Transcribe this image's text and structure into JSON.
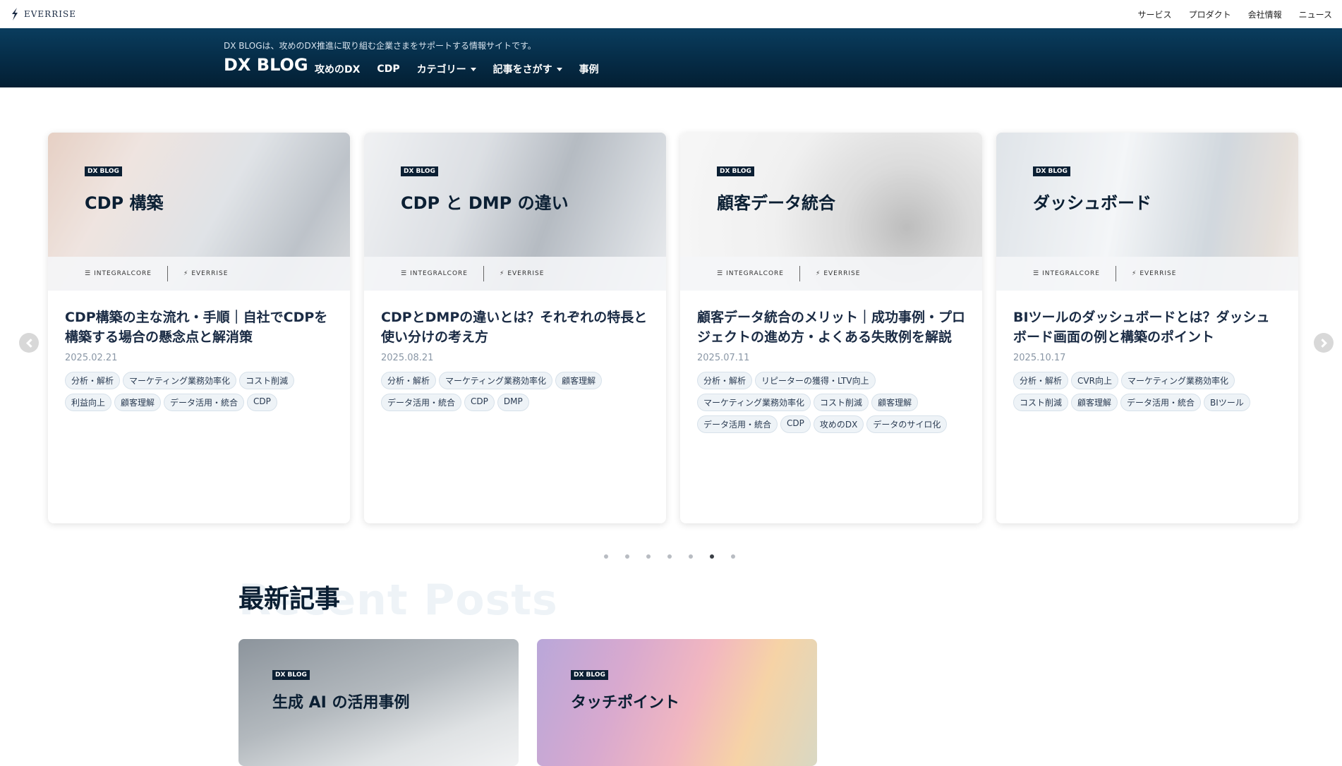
{
  "topbar": {
    "brand": "EVERRISE",
    "nav": [
      "サービス",
      "プロダクト",
      "会社情報",
      "ニュース"
    ]
  },
  "dxheader": {
    "tagline": "DX BLOGは、攻めのDX推進に取り組む企業さまをサポートする情報サイトです。",
    "logo": "DX BLOG",
    "nav": [
      {
        "label": "攻めのDX",
        "dropdown": false
      },
      {
        "label": "CDP",
        "dropdown": false
      },
      {
        "label": "カテゴリー",
        "dropdown": true
      },
      {
        "label": "記事をさがす",
        "dropdown": true
      },
      {
        "label": "事例",
        "dropdown": false
      }
    ]
  },
  "logos": {
    "integralcore": "INTEGRALCORE",
    "everrise": "EVERRISE"
  },
  "cards": [
    {
      "badge": "DX BLOG",
      "thumb_title": "CDP 構築",
      "title": "CDP構築の主な流れ・手順｜自社でCDPを構築する場合の懸念点と解消策",
      "date": "2025.02.21",
      "tags": [
        "分析・解析",
        "マーケティング業務効率化",
        "コスト削減",
        "利益向上",
        "顧客理解",
        "データ活用・統合",
        "CDP"
      ]
    },
    {
      "badge": "DX BLOG",
      "thumb_title": "CDP と DMP の違い",
      "title": "CDPとDMPの違いとは？それぞれの特長と使い分けの考え方",
      "date": "2025.08.21",
      "tags": [
        "分析・解析",
        "マーケティング業務効率化",
        "顧客理解",
        "データ活用・統合",
        "CDP",
        "DMP"
      ]
    },
    {
      "badge": "DX BLOG",
      "thumb_title": "顧客データ統合",
      "title": "顧客データ統合のメリット｜成功事例・プロジェクトの進め方・よくある失敗例を解説",
      "date": "2025.07.11",
      "tags": [
        "分析・解析",
        "リピーターの獲得・LTV向上",
        "マーケティング業務効率化",
        "コスト削減",
        "顧客理解",
        "データ活用・統合",
        "CDP",
        "攻めのDX",
        "データのサイロ化"
      ]
    },
    {
      "badge": "DX BLOG",
      "thumb_title": "ダッシュボード",
      "title": "BIツールのダッシュボードとは？ダッシュボード画面の例と構築のポイント",
      "date": "2025.10.17",
      "tags": [
        "分析・解析",
        "CVR向上",
        "マーケティング業務効率化",
        "コスト削減",
        "顧客理解",
        "データ活用・統合",
        "BIツール"
      ]
    }
  ],
  "carousel": {
    "dot_count": 7,
    "active_dot": 5
  },
  "recent": {
    "title": "最新記事",
    "bg_text": "Recent Posts",
    "posts": [
      {
        "badge": "DX BLOG",
        "thumb_title": "生成 AI の活用事例"
      },
      {
        "badge": "DX BLOG",
        "thumb_title": "タッチポイント"
      }
    ]
  },
  "colors": {
    "header_dark": "#041f33",
    "header_light": "#0a3d5e",
    "badge": "#0b1f33",
    "tag_bg": "#eef3f7"
  }
}
